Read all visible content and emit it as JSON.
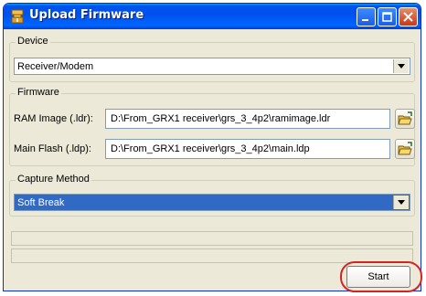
{
  "window": {
    "title": "Upload Firmware"
  },
  "device": {
    "legend": "Device",
    "selected": "Receiver/Modem"
  },
  "firmware": {
    "legend": "Firmware",
    "ram_label": "RAM Image (.ldr):",
    "ram_path": "D:\\From_GRX1 receiver\\grs_3_4p2\\ramimage.ldr",
    "flash_label": "Main Flash (.ldp):",
    "flash_path": "D:\\From_GRX1 receiver\\grs_3_4p2\\main.ldp"
  },
  "capture": {
    "legend": "Capture Method",
    "selected": "Soft Break"
  },
  "buttons": {
    "start": "Start"
  },
  "colors": {
    "selection": "#316ac5",
    "highlight": "#d12525",
    "titlebar": "#0053ee"
  }
}
